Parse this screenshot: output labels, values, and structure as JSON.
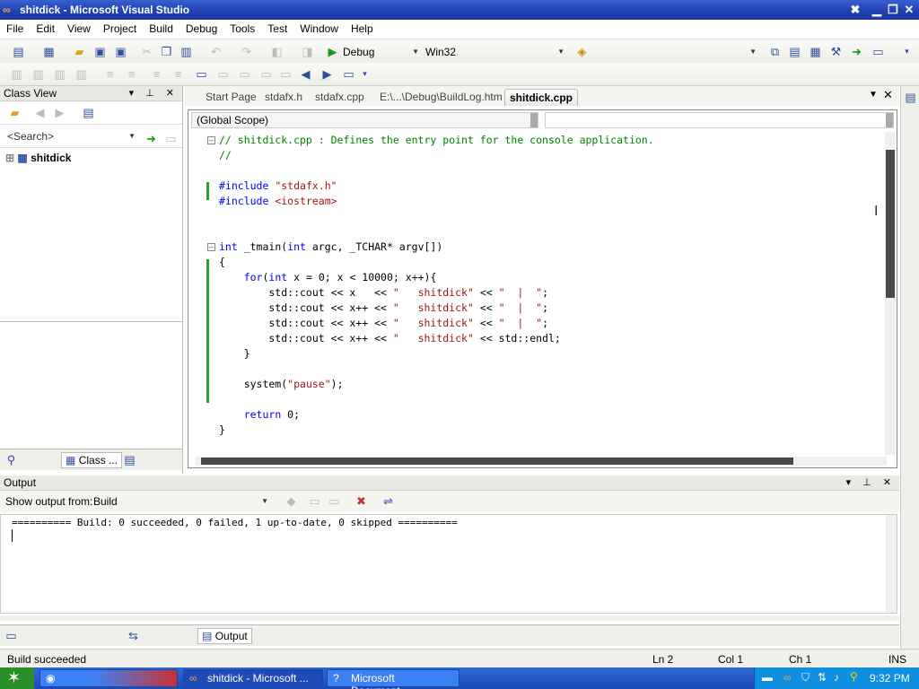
{
  "window": {
    "title": "shitdick - Microsoft Visual Studio"
  },
  "menu": [
    "File",
    "Edit",
    "View",
    "Project",
    "Build",
    "Debug",
    "Tools",
    "Test",
    "Window",
    "Help"
  ],
  "toolbar": {
    "config": "Debug",
    "platform": "Win32",
    "find": ""
  },
  "classview": {
    "title": "Class View",
    "search_placeholder": "<Search>",
    "tree_root": "shitdick",
    "bottom_tab": "Class ..."
  },
  "doc_tabs": [
    "Start Page",
    "stdafx.h",
    "stdafx.cpp",
    "E:\\...\\Debug\\BuildLog.htm",
    "shitdick.cpp"
  ],
  "scope": {
    "left": "(Global Scope)",
    "right": ""
  },
  "code_lines": [
    "// shitdick.cpp : Defines the entry point for the console application.",
    "//",
    "",
    "#include \"stdafx.h\"",
    "#include <iostream>",
    "",
    "",
    "int _tmain(int argc, _TCHAR* argv[])",
    "{",
    "    for(int x = 0; x < 10000; x++){",
    "        std::cout << x   << \"   shitdick\" << \"  |  \";",
    "        std::cout << x++ << \"   shitdick\" << \"  |  \";",
    "        std::cout << x++ << \"   shitdick\" << \"  |  \";",
    "        std::cout << x++ << \"   shitdick\" << std::endl;",
    "    }",
    "",
    "    system(\"pause\");",
    "",
    "    return 0;",
    "}"
  ],
  "output": {
    "title": "Output",
    "show_from_label": "Show output from:",
    "source": "Build",
    "text": "========== Build: 0 succeeded, 0 failed, 1 up-to-date, 0 skipped ==========",
    "bottom_tab": "Output"
  },
  "status": {
    "message": "Build succeeded",
    "ln": "Ln 2",
    "col": "Col 1",
    "ch": "Ch 1",
    "mode": "INS"
  },
  "taskbar": {
    "tasks": [
      "",
      "shitdick - Microsoft ...",
      "Microsoft Document..."
    ],
    "time": "9:32 PM"
  }
}
